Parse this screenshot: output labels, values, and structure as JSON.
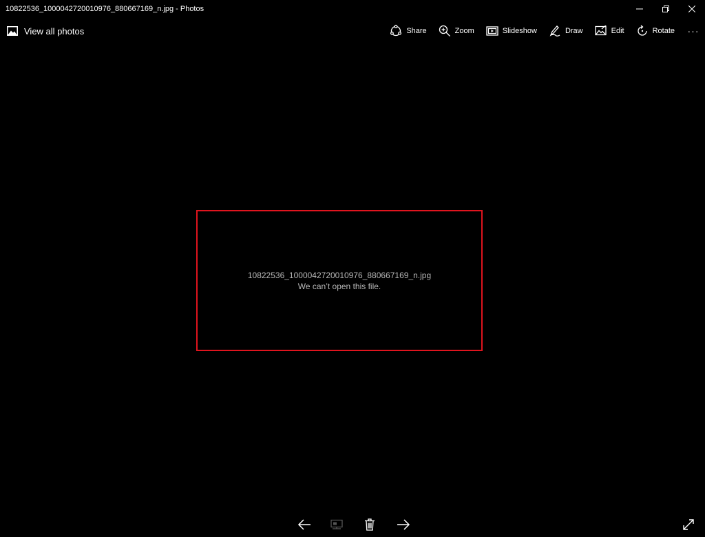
{
  "window": {
    "title": "10822536_1000042720010976_880667169_n.jpg - Photos",
    "controls": [
      "minimize",
      "restore",
      "close"
    ]
  },
  "commandbar": {
    "back_label": "View all photos",
    "back_icon": "photos-icon",
    "actions": [
      {
        "label": "Share",
        "icon": "share-icon"
      },
      {
        "label": "Zoom",
        "icon": "zoom-icon"
      },
      {
        "label": "Slideshow",
        "icon": "slideshow-icon"
      },
      {
        "label": "Draw",
        "icon": "draw-icon"
      },
      {
        "label": "Edit",
        "icon": "edit-icon"
      },
      {
        "label": "Rotate",
        "icon": "rotate-icon"
      }
    ],
    "more_label": "···"
  },
  "viewer": {
    "file_name": "10822536_1000042720010976_880667169_n.jpg",
    "error_message": "We can’t open this file.",
    "highlight_color": "#e0141e"
  },
  "bottombar": {
    "icons": [
      "previous-arrow-icon",
      "presentation-icon",
      "delete-icon",
      "next-arrow-icon",
      "fullscreen-icon"
    ]
  }
}
